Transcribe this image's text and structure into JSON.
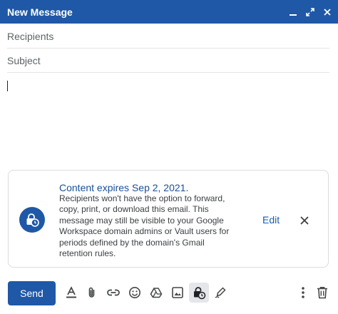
{
  "window": {
    "title": "New Message"
  },
  "compose": {
    "recipients_placeholder": "Recipients",
    "subject_placeholder": "Subject"
  },
  "confidential_notice": {
    "heading": "Content expires Sep 2, 2021.",
    "description": "Recipients won't have the option to forward, copy, print, or download this email. This message may still be visible to your Google Workspace domain admins or Vault users for periods defined by the domain's Gmail retention rules.",
    "edit_label": "Edit"
  },
  "toolbar": {
    "send_label": "Send",
    "icons": [
      "formatting-icon",
      "attach-icon",
      "link-icon",
      "emoji-icon",
      "drive-icon",
      "photo-icon",
      "confidential-mode-icon",
      "signature-icon",
      "more-options-icon",
      "discard-icon"
    ]
  },
  "colors": {
    "accent": "#1f58a6",
    "link": "#1a5db3"
  }
}
